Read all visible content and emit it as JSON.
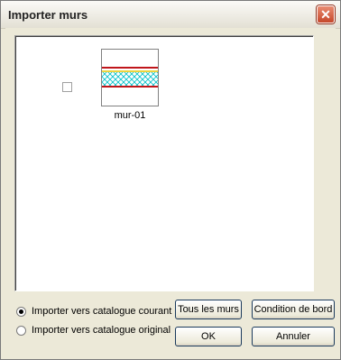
{
  "window": {
    "title": "Importer murs",
    "close_icon": "close-icon"
  },
  "list": {
    "items": [
      {
        "label": "mur-01",
        "checked": false,
        "thumbnail_icon": "wall-section-thumbnail"
      }
    ]
  },
  "options": {
    "radio_current": "Importer vers catalogue courant",
    "radio_original": "Importer vers catalogue original",
    "selected": "radio_current"
  },
  "buttons": {
    "all_walls": "Tous les murs",
    "edge_condition": "Condition de bord",
    "ok": "OK",
    "cancel": "Annuler"
  },
  "colors": {
    "wall_line_red": "#c0161b",
    "wall_line_yellow": "#e6c500",
    "wall_hatch_cyan": "#00c0c8"
  }
}
